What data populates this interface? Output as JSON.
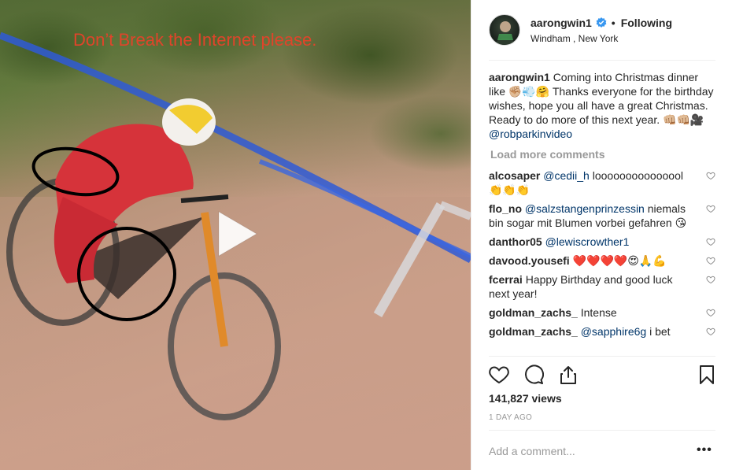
{
  "video": {
    "overlay_text": "Don’t Break the Internet please."
  },
  "header": {
    "username": "aarongwin1",
    "separator": "•",
    "follow_status": "Following",
    "location": "Windham , New York"
  },
  "caption": {
    "username": "aarongwin1",
    "text": "Coming into Christmas dinner like ✊🏼💨🤗 Thanks everyone for the birthday wishes, hope you all have a great Christmas. Ready to do more of this next year. 👊🏼👊🏼🎥 ",
    "mention": "@robparkinvideo"
  },
  "load_more_label": "Load more comments",
  "comments": [
    {
      "user": "alcosaper",
      "mention": "@cedii_h",
      "text": " looooooooooooool 👏👏👏"
    },
    {
      "user": "flo_no",
      "mention": "@salzstangenprinzessin",
      "text": " niemals bin sogar mit Blumen vorbei gefahren 😘"
    },
    {
      "user": "danthor05",
      "mention": "@lewiscrowther1",
      "text": ""
    },
    {
      "user": "davood.yousefi",
      "mention": "",
      "text": "❤️❤️❤️❤️😍🙏💪"
    },
    {
      "user": "fcerrai",
      "mention": "",
      "text": "Happy Birthday and good luck next year!"
    },
    {
      "user": "goldman_zachs_",
      "mention": "",
      "text": "Intense"
    },
    {
      "user": "goldman_zachs_",
      "mention": "@sapphire6g",
      "text": " i bet"
    }
  ],
  "stats": {
    "views": "141,827 views",
    "timestamp": "1 DAY AGO"
  },
  "comment_box": {
    "placeholder": "Add a comment...",
    "more_label": "•••"
  },
  "colors": {
    "mention": "#003569",
    "muted": "#999999",
    "verified": "#3897f0",
    "overlay_text": "#e0442a"
  }
}
